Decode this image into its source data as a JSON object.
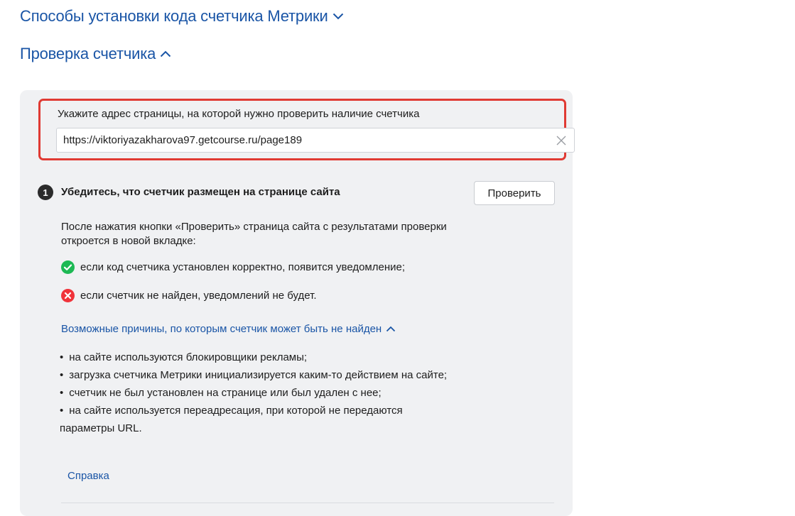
{
  "sections": {
    "install_methods": "Способы установки кода счетчика Метрики",
    "counter_check": "Проверка счетчика"
  },
  "url_check": {
    "label": "Укажите адрес страницы, на которой нужно проверить наличие счетчика",
    "value": "https://viktoriyazakharova97.getcourse.ru/page189"
  },
  "step": {
    "number": "1",
    "title": "Убедитесь, что счетчик размещен на странице сайта",
    "button_label": "Проверить",
    "description": "После нажатия кнопки «Проверить» страница сайта с результатами проверки откроется в новой вкладке:",
    "status_ok": "если код счетчика установлен корректно, появится уведомление;",
    "status_fail": "если счетчик не найден, уведомлений не будет.",
    "reasons_toggle": "Возможные причины, по которым счетчик может быть не найден",
    "reasons": [
      "на сайте используются блокировщики рекламы;",
      "загрузка счетчика Метрики инициализируется каким-то действием на сайте;",
      "счетчик не был установлен на странице или был удален с нее;",
      "на сайте используется переадресация, при которой не передаются параметры URL."
    ],
    "help_link": "Справка"
  },
  "colors": {
    "link": "#1a55a6",
    "highlight_border": "#e03a33",
    "success": "#1db954",
    "error": "#f0333a",
    "panel_bg": "#f0f1f3"
  },
  "icons": {
    "install_chevron": "chevron-down-icon",
    "check_chevron": "chevron-up-icon",
    "clear": "close-icon",
    "ok": "check-circle-icon",
    "fail": "cross-circle-icon",
    "reasons_chevron": "chevron-up-icon"
  }
}
